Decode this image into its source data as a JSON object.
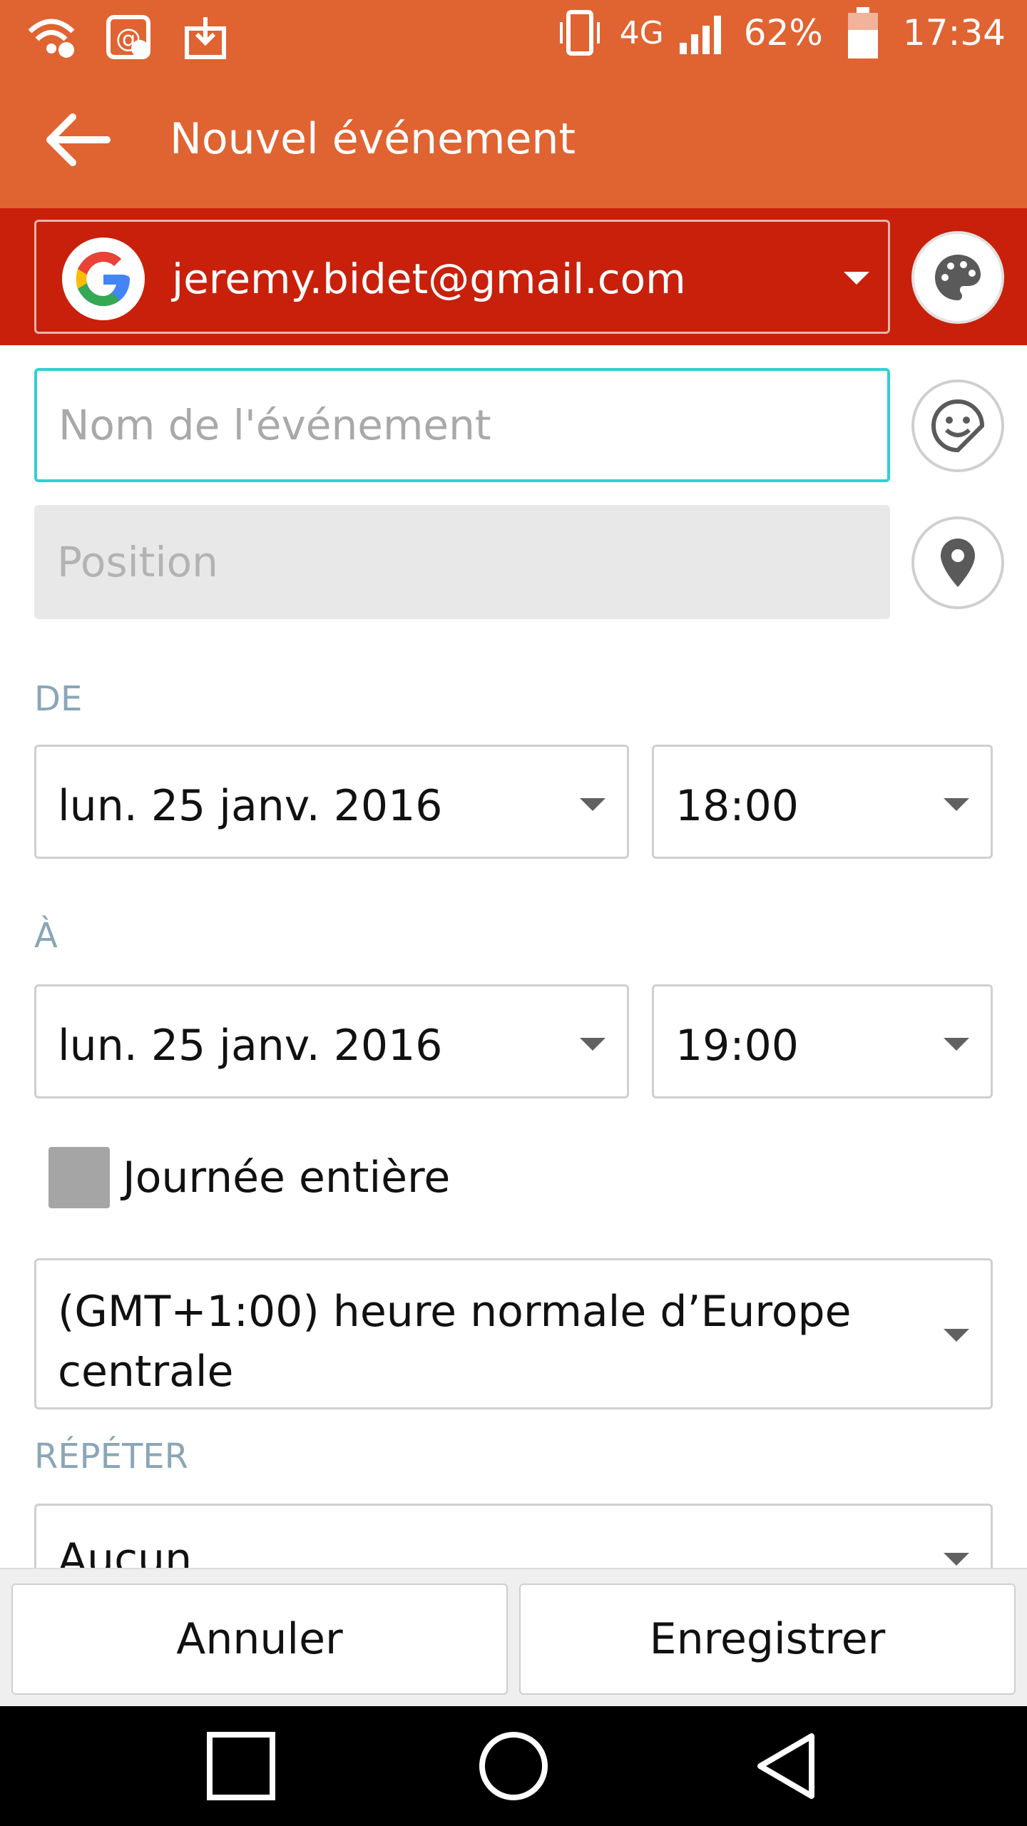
{
  "status_bar": {
    "battery": "62%",
    "time": "17:34",
    "network": "4G"
  },
  "app_bar": {
    "title": "Nouvel événement"
  },
  "account": {
    "email": "jeremy.bidet@gmail.com"
  },
  "event": {
    "name_placeholder": "Nom de l'événement",
    "name_value": "",
    "position_placeholder": "Position",
    "position_value": ""
  },
  "from": {
    "label": "DE",
    "date": "lun. 25 janv. 2016",
    "time": "18:00"
  },
  "to": {
    "label": "À",
    "date": "lun. 25 janv. 2016",
    "time": "19:00"
  },
  "all_day": {
    "label": "Journée entière",
    "checked": false
  },
  "timezone": {
    "value": "(GMT+1:00) heure normale d’Europe centrale"
  },
  "repeat": {
    "label": "RÉPÉTER",
    "value": "Aucun"
  },
  "actions": {
    "cancel": "Annuler",
    "save": "Enregistrer"
  },
  "colors": {
    "app_bar": "#e06332",
    "account_strip": "#c8200a",
    "input_focus": "#2fd0d2",
    "section_label": "#8aa6b8"
  }
}
